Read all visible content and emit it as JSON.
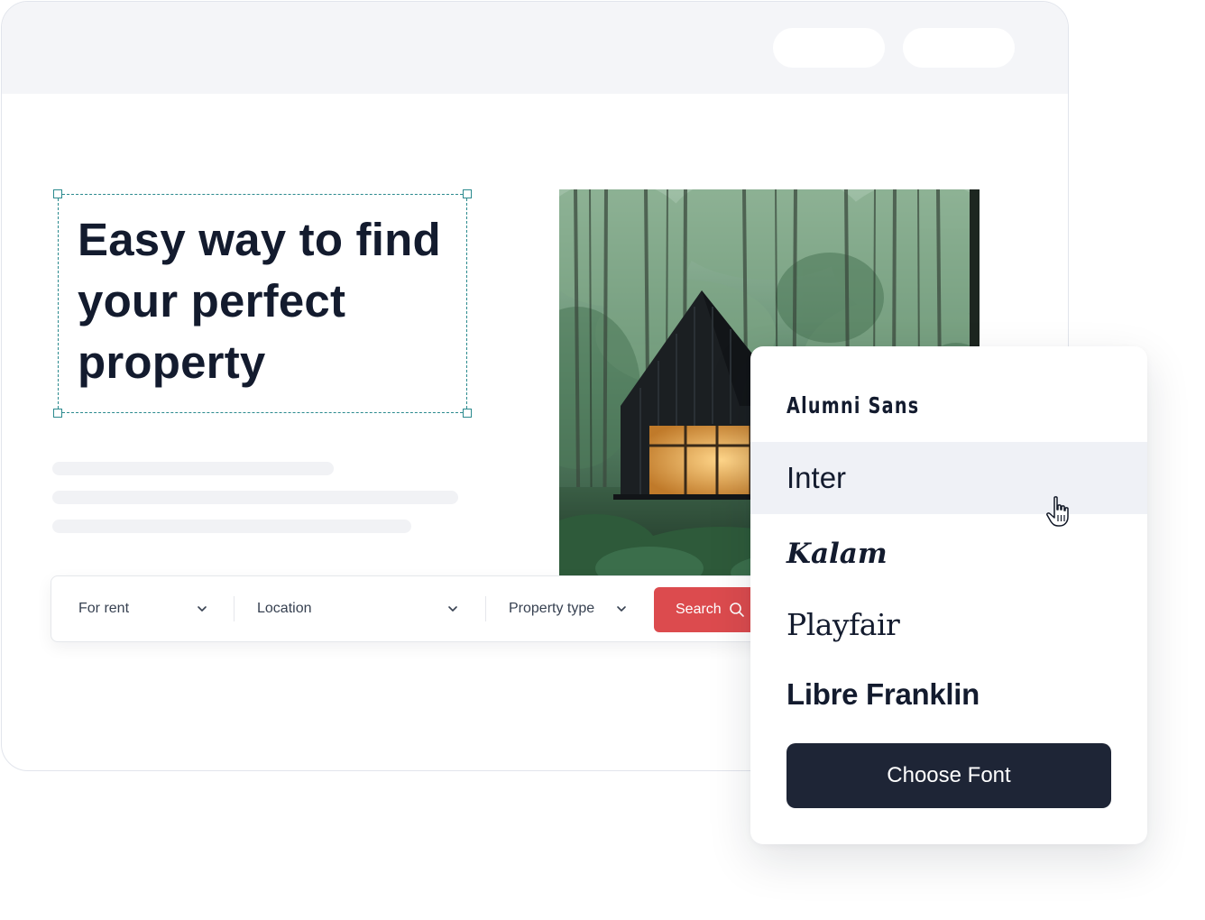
{
  "hero": {
    "headline": "Easy way to find your perfect property"
  },
  "search_bar": {
    "listing_type": "For rent",
    "location": "Location",
    "property_type": "Property type",
    "search_label": "Search"
  },
  "font_menu": {
    "options": [
      {
        "label": "Alumni Sans",
        "hovered": false
      },
      {
        "label": "Inter",
        "hovered": true
      },
      {
        "label": "Kalam",
        "hovered": false
      },
      {
        "label": "Playfair",
        "hovered": false
      },
      {
        "label": "Libre Franklin",
        "hovered": false
      }
    ],
    "choose_label": "Choose Font"
  },
  "colors": {
    "accent_red": "#dc4b4e",
    "dark_button": "#1e2536",
    "selection_teal": "#2b8a8e",
    "hover_row": "#eff1f6",
    "headline_text": "#131b2e"
  },
  "icons": {
    "chevron": "chevron-down-icon",
    "search": "search-icon",
    "cursor": "hand-pointer-icon"
  }
}
